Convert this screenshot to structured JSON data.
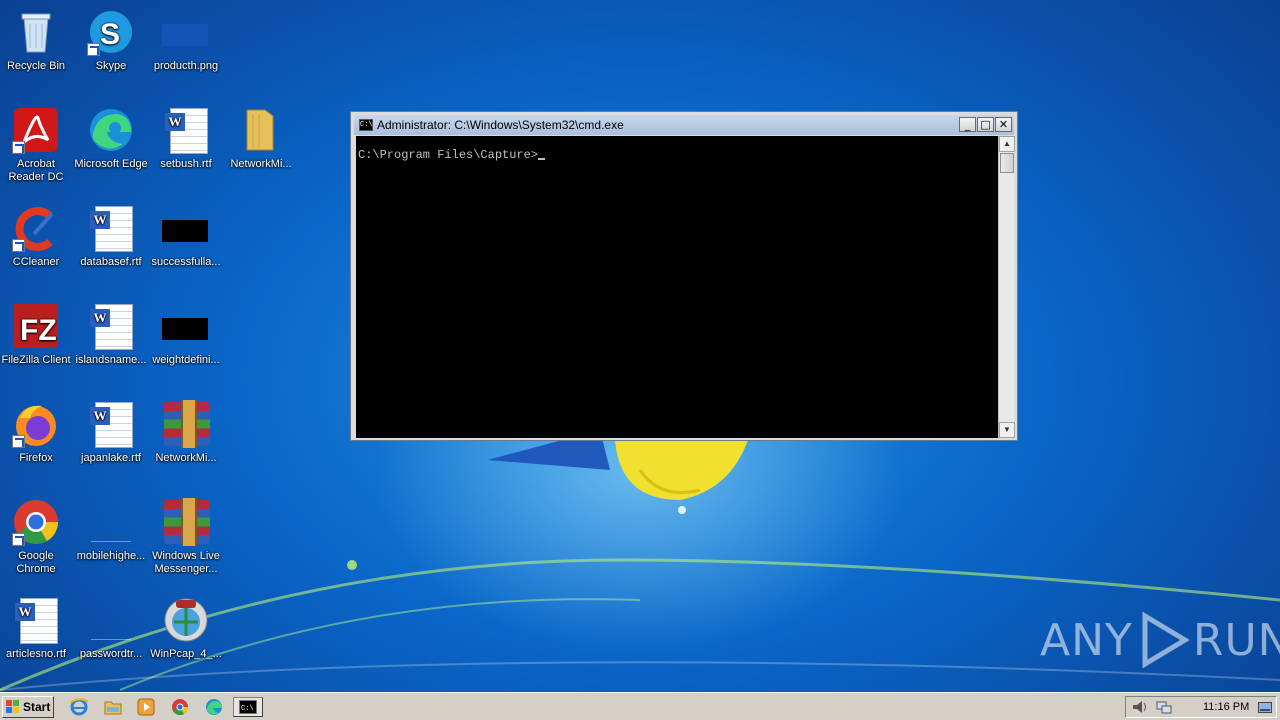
{
  "desktop": {
    "icons": [
      {
        "label": "Recycle Bin",
        "icon": "recycle-bin-icon"
      },
      {
        "label": "Skype",
        "icon": "skype-icon"
      },
      {
        "label": "producth.png",
        "icon": "image-file-icon"
      },
      {
        "label": "Acrobat Reader DC",
        "icon": "acrobat-reader-icon"
      },
      {
        "label": "Microsoft Edge",
        "icon": "edge-icon"
      },
      {
        "label": "setbush.rtf",
        "icon": "word-document-icon"
      },
      {
        "label": "NetworkMi...",
        "icon": "folder-icon"
      },
      {
        "label": "CCleaner",
        "icon": "ccleaner-icon"
      },
      {
        "label": "databasef.rtf",
        "icon": "word-document-icon"
      },
      {
        "label": "successfulla...",
        "icon": "image-file-icon"
      },
      {
        "label": "FileZilla Client",
        "icon": "filezilla-icon"
      },
      {
        "label": "islandsname...",
        "icon": "word-document-icon"
      },
      {
        "label": "weightdefini...",
        "icon": "image-file-icon"
      },
      {
        "label": "Firefox",
        "icon": "firefox-icon"
      },
      {
        "label": "japanlake.rtf",
        "icon": "word-document-icon"
      },
      {
        "label": "NetworkMi...",
        "icon": "winrar-icon"
      },
      {
        "label": "Google Chrome",
        "icon": "chrome-icon"
      },
      {
        "label": "mobilehighe...",
        "icon": "file-icon"
      },
      {
        "label": "Windows Live Messenger...",
        "icon": "winrar-icon"
      },
      {
        "label": "articlesno.rtf",
        "icon": "word-document-icon"
      },
      {
        "label": "passwordtr...",
        "icon": "file-icon"
      },
      {
        "label": "WinPcap_4_...",
        "icon": "winpcap-icon"
      }
    ]
  },
  "cmd_window": {
    "title": "Administrator: C:\\Windows\\System32\\cmd.exe",
    "app_icon_text": "C:\\",
    "prompt": "C:\\Program Files\\Capture>",
    "buttons": {
      "minimize": "_",
      "maximize": "□",
      "close": "✕"
    }
  },
  "taskbar": {
    "start_label": "Start",
    "clock": "11:16 PM",
    "pinned": [
      "internet-explorer-icon",
      "explorer-icon",
      "media-player-icon",
      "chrome-icon",
      "edge-icon",
      "cmd-icon"
    ]
  },
  "watermark": {
    "text_left": "ANY",
    "text_right": "RUN"
  }
}
